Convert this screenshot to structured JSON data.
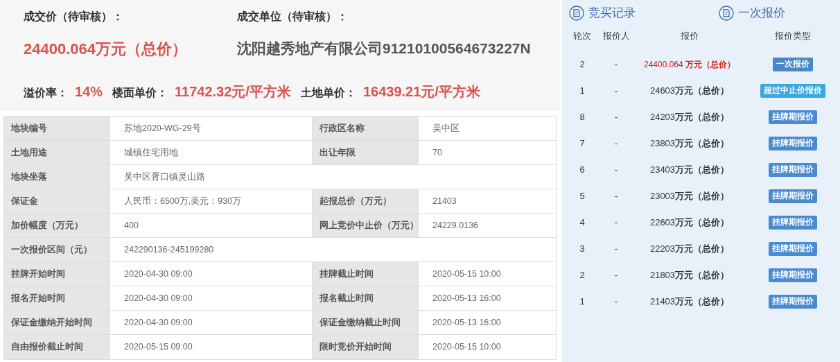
{
  "summary": {
    "price_label": "成交价（待审核）：",
    "price": "24400.064万元（总价）",
    "buyer_label": "成交单位（待审核）：",
    "buyer": "沈阳越秀地产有限公司91210100564673227N",
    "stats": [
      {
        "label": "溢价率：",
        "value": "14%"
      },
      {
        "label": "楼面单价：",
        "value": "11742.32元/平方米"
      },
      {
        "label": "土地单价：",
        "value": "16439.21元/平方米"
      }
    ]
  },
  "table": {
    "rows": [
      [
        {
          "label": "地块编号",
          "value": "苏地2020-WG-29号"
        },
        {
          "label": "行政区名称",
          "value": "吴中区"
        }
      ],
      [
        {
          "label": "土地用途",
          "value": "城镇住宅用地"
        },
        {
          "label": "出让年限",
          "value": "70"
        }
      ],
      [
        {
          "label": "地块坐落",
          "value": "吴中区胥口镇灵山路"
        }
      ],
      [
        {
          "label": "保证金",
          "value": "人民币：6500万,美元：930万"
        },
        {
          "label": "起报总价（万元）",
          "value": "21403"
        }
      ],
      [
        {
          "label": "加价幅度（万元）",
          "value": "400"
        },
        {
          "label": "网上竞价中止价（万元）",
          "value": "24229.0136"
        }
      ],
      [
        {
          "label": "一次报价区间（元）",
          "value": "242290136-245199280"
        }
      ],
      [
        {
          "label": "挂牌开始时间",
          "value": "2020-04-30 09:00"
        },
        {
          "label": "挂牌截止时间",
          "value": "2020-05-15 10:00"
        }
      ],
      [
        {
          "label": "报名开始时间",
          "value": "2020-04-30 09:00"
        },
        {
          "label": "报名截止时间",
          "value": "2020-05-13 16:00"
        }
      ],
      [
        {
          "label": "保证金缴纳开始时间",
          "value": "2020-04-30 09:00"
        },
        {
          "label": "保证金缴纳截止时间",
          "value": "2020-05-13 16:00"
        }
      ],
      [
        {
          "label": "自由报价截止时间",
          "value": "2020-05-15 09:00"
        },
        {
          "label": "限时竞价开始时间",
          "value": "2020-05-15 10:00"
        }
      ]
    ]
  },
  "bids": {
    "tabs": [
      {
        "label": "竞买记录"
      },
      {
        "label": "一次报价"
      }
    ],
    "columns": [
      "轮次",
      "报价人",
      "报价",
      "报价类型"
    ],
    "rows": [
      {
        "round": "2",
        "bidder": "-",
        "price": "24400.064 **万元（总价）**",
        "type": "一次报价",
        "color": "#4a86c8",
        "highlight": true
      },
      {
        "round": "1",
        "bidder": "-",
        "price": "24603**万元（总价）**",
        "type": "超过中止价报价",
        "color": "#3aa8e0",
        "highlight": false
      },
      {
        "round": "8",
        "bidder": "-",
        "price": "24203**万元（总价）**",
        "type": "挂牌期报价",
        "color": "#4a8bd0",
        "highlight": false
      },
      {
        "round": "7",
        "bidder": "-",
        "price": "23803**万元（总价）**",
        "type": "挂牌期报价",
        "color": "#4a8bd0",
        "highlight": false
      },
      {
        "round": "6",
        "bidder": "-",
        "price": "23403**万元（总价）**",
        "type": "挂牌期报价",
        "color": "#4a8bd0",
        "highlight": false
      },
      {
        "round": "5",
        "bidder": "-",
        "price": "23003**万元（总价）**",
        "type": "挂牌期报价",
        "color": "#4a8bd0",
        "highlight": false
      },
      {
        "round": "4",
        "bidder": "-",
        "price": "22603**万元（总价）**",
        "type": "挂牌期报价",
        "color": "#4a8bd0",
        "highlight": false
      },
      {
        "round": "3",
        "bidder": "-",
        "price": "22203**万元（总价）**",
        "type": "挂牌期报价",
        "color": "#4a8bd0",
        "highlight": false
      },
      {
        "round": "2",
        "bidder": "-",
        "price": "21803**万元（总价）**",
        "type": "挂牌期报价",
        "color": "#4a8bd0",
        "highlight": false
      },
      {
        "round": "1",
        "bidder": "-",
        "price": "21403**万元（总价）**",
        "type": "挂牌期报价",
        "color": "#4a8bd0",
        "highlight": false
      }
    ]
  }
}
